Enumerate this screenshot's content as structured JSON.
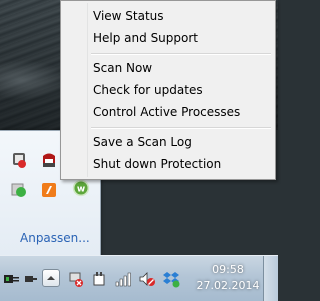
{
  "context_menu": {
    "items": [
      {
        "id": "view-status",
        "label": "View Status"
      },
      {
        "id": "help-and-support",
        "label": "Help and Support"
      },
      {
        "id": "scan-now",
        "label": "Scan Now"
      },
      {
        "id": "check-for-updates",
        "label": "Check for updates"
      },
      {
        "id": "control-active-processes",
        "label": "Control Active Processes"
      },
      {
        "id": "save-scan-log",
        "label": "Save a Scan Log"
      },
      {
        "id": "shut-down-protection",
        "label": "Shut down Protection"
      }
    ]
  },
  "tray_panel": {
    "customize_label": "Anpassen...",
    "icons": [
      "security-shield-icon",
      "antivirus-alert-icon",
      "green-status-icon",
      "orange-app-icon",
      "webroot-icon"
    ]
  },
  "taskbar": {
    "clock": {
      "time": "09:58",
      "date": "27.02.2014"
    },
    "icons": [
      "battery-plug-icon",
      "show-hidden-icons-arrow",
      "network-disabled-icon",
      "power-icon",
      "signal-bars-icon",
      "speaker-muted-icon",
      "dropbox-icon"
    ]
  },
  "colors": {
    "menu_bg": "#f0f0f0",
    "menu_border": "#979797",
    "link": "#2a63b5",
    "taskbar": "#b3c5d6"
  }
}
